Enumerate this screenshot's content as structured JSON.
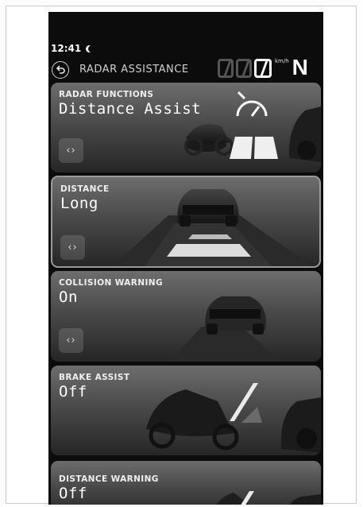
{
  "status": {
    "time": "12:41"
  },
  "header": {
    "title": "RADAR ASSISTANCE",
    "speed_unit": "km/h",
    "gear": "N"
  },
  "cards": [
    {
      "label": "RADAR FUNCTIONS",
      "value": "Distance Assist",
      "arrows": "‹›"
    },
    {
      "label": "DISTANCE",
      "value": "Long",
      "arrows": "‹›"
    },
    {
      "label": "COLLISION WARNING",
      "value": "On",
      "arrows": "‹›"
    },
    {
      "label": "BRAKE ASSIST",
      "value": "Off"
    },
    {
      "label": "DISTANCE WARNING",
      "value": "Off"
    }
  ],
  "colors": {
    "screen_bg": "#0c0c0c",
    "text": "#ffffff",
    "dim": "#555555"
  }
}
